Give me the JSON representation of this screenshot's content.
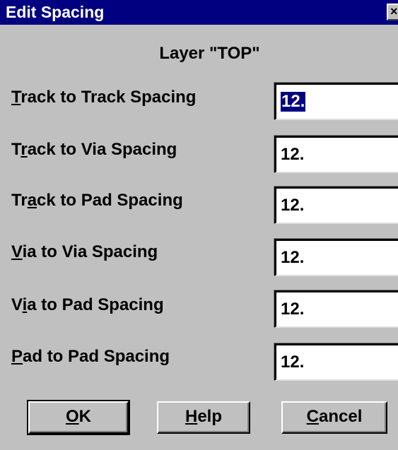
{
  "window": {
    "title": "Edit Spacing",
    "close_glyph": "×"
  },
  "layer": {
    "label": "Layer \"TOP\""
  },
  "fields": [
    {
      "pre": "",
      "mnemonic": "T",
      "post": "rack to Track Spacing",
      "value": "12."
    },
    {
      "pre": "T",
      "mnemonic": "r",
      "post": "ack to Via Spacing",
      "value": "12."
    },
    {
      "pre": "Tr",
      "mnemonic": "a",
      "post": "ck to Pad Spacing",
      "value": "12."
    },
    {
      "pre": "",
      "mnemonic": "V",
      "post": "ia to Via Spacing",
      "value": "12."
    },
    {
      "pre": "V",
      "mnemonic": "i",
      "post": "a to Pad Spacing",
      "value": "12."
    },
    {
      "pre": "",
      "mnemonic": "P",
      "post": "ad to Pad Spacing",
      "value": "12."
    }
  ],
  "buttons": {
    "ok": {
      "pre": "",
      "mnemonic": "O",
      "post": "K"
    },
    "help": {
      "pre": "",
      "mnemonic": "H",
      "post": "elp"
    },
    "cancel": {
      "pre": "",
      "mnemonic": "C",
      "post": "ancel"
    }
  },
  "colors": {
    "face": "#c0c0c0",
    "titlebar": "#000080",
    "selection": "#000080"
  },
  "icons": {
    "close": "close-icon"
  }
}
